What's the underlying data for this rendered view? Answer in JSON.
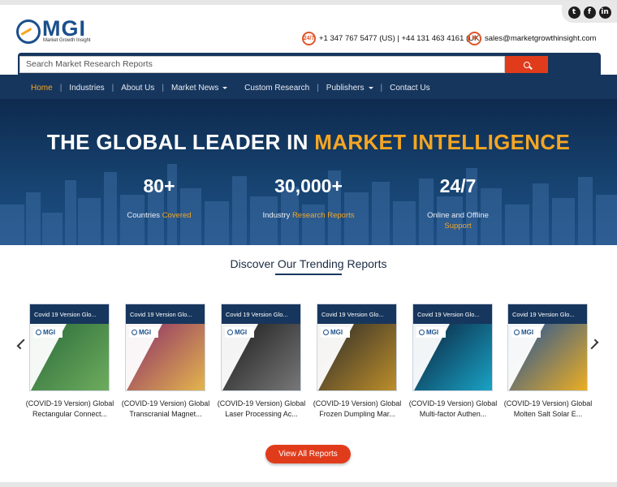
{
  "social": [
    "t",
    "f",
    "in"
  ],
  "logo": {
    "text": "MGI",
    "subtitle": "Market Growth Insight"
  },
  "contact": {
    "phone_badge": "24/7",
    "phone": "+1 347 767 5477 (US) | +44 131 463 4161 (UK)",
    "email": "sales@marketgrowthinsight.com"
  },
  "search": {
    "placeholder": "Search Market Research Reports"
  },
  "nav": {
    "items": [
      "Home",
      "Industries",
      "About Us",
      "Market News",
      "Custom Research",
      "Publishers",
      "Contact Us"
    ],
    "active": "Home"
  },
  "hero": {
    "title_part1": "THE GLOBAL LEADER IN",
    "title_part2": "MARKET INTELLIGENCE",
    "stats": [
      {
        "number": "80+",
        "label": "Countries",
        "label_hl": "Covered"
      },
      {
        "number": "30,000+",
        "label": "Industry",
        "label_hl": "Research Reports"
      },
      {
        "number": "24/7",
        "label": "Online and Offline",
        "label_hl": "Support"
      }
    ]
  },
  "trending": {
    "title": "Discover Our Trending Reports",
    "cards": [
      {
        "head": "Covid 19 Version Glo...",
        "line1": "(COVID-19 Version) Global",
        "line2": "Rectangular Connect...",
        "color1": "#2a6a3a",
        "color2": "#6fae5e"
      },
      {
        "head": "Covid 19 Version Glo...",
        "line1": "(COVID-19 Version) Global",
        "line2": "Transcranial Magnet...",
        "color1": "#8a2a6a",
        "color2": "#e5b84c"
      },
      {
        "head": "Covid 19 Version Glo...",
        "line1": "(COVID-19 Version) Global",
        "line2": "Laser Processing Ac...",
        "color1": "#1a1a1a",
        "color2": "#7a7a7a"
      },
      {
        "head": "Covid 19 Version Glo...",
        "line1": "(COVID-19 Version) Global",
        "line2": "Frozen Dumpling Mar...",
        "color1": "#2a2a2a",
        "color2": "#c0902a"
      },
      {
        "head": "Covid 19 Version Glo...",
        "line1": "(COVID-19 Version) Global",
        "line2": "Multi-factor Authen...",
        "color1": "#0a1e3a",
        "color2": "#1aa6c8"
      },
      {
        "head": "Covid 19 Version Glo...",
        "line1": "(COVID-19 Version) Global",
        "line2": "Molten Salt Solar E...",
        "color1": "#1c4f9c",
        "color2": "#f0b020"
      }
    ],
    "view_all": "View All Reports"
  },
  "colors": {
    "navy": "#17365d",
    "accent": "#f5a623",
    "button": "#e03c1c"
  }
}
